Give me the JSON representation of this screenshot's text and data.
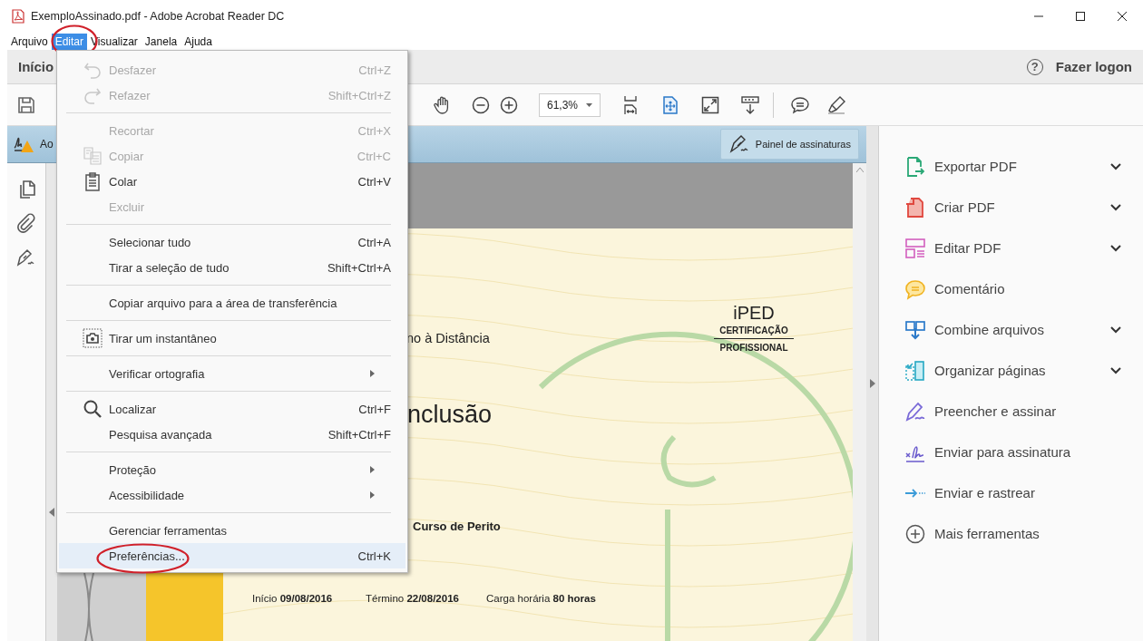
{
  "window": {
    "title": "ExemploAssinado.pdf - Adobe Acrobat Reader DC"
  },
  "menu_bar": [
    {
      "label": "Arquivo",
      "selected": false,
      "circled": false
    },
    {
      "label": "Editar",
      "selected": true,
      "circled": true
    },
    {
      "label": "Visualizar",
      "selected": false,
      "circled": false
    },
    {
      "label": "Janela",
      "selected": false,
      "circled": false
    },
    {
      "label": "Ajuda",
      "selected": false,
      "circled": false
    }
  ],
  "tab_bar": {
    "tab": "Início",
    "help": "?",
    "login": "Fazer logon"
  },
  "toolbar": {
    "zoom": "61,3%"
  },
  "signature_bar": {
    "message": "Ao",
    "button": "Painel de assinaturas"
  },
  "edit_menu": [
    {
      "kind": "item",
      "label": "Desfazer",
      "shortcut": "Ctrl+Z",
      "disabled": true,
      "submenu": false,
      "selected": false,
      "circled": false
    },
    {
      "kind": "item",
      "label": "Refazer",
      "shortcut": "Shift+Ctrl+Z",
      "disabled": true,
      "submenu": false,
      "selected": false,
      "circled": false
    },
    {
      "kind": "separator"
    },
    {
      "kind": "item",
      "label": "Recortar",
      "shortcut": "Ctrl+X",
      "disabled": true,
      "submenu": false,
      "selected": false,
      "circled": false
    },
    {
      "kind": "item",
      "label": "Copiar",
      "shortcut": "Ctrl+C",
      "disabled": true,
      "submenu": false,
      "selected": false,
      "circled": false
    },
    {
      "kind": "item",
      "label": "Colar",
      "shortcut": "Ctrl+V",
      "disabled": false,
      "submenu": false,
      "selected": false,
      "circled": false
    },
    {
      "kind": "item",
      "label": "Excluir",
      "disabled": true,
      "submenu": false,
      "selected": false,
      "circled": false
    },
    {
      "kind": "separator"
    },
    {
      "kind": "item",
      "label": "Selecionar tudo",
      "shortcut": "Ctrl+A",
      "disabled": false,
      "submenu": false,
      "selected": false,
      "circled": false
    },
    {
      "kind": "item",
      "label": "Tirar a seleção de tudo",
      "shortcut": "Shift+Ctrl+A",
      "disabled": false,
      "submenu": false,
      "selected": false,
      "circled": false
    },
    {
      "kind": "separator"
    },
    {
      "kind": "item",
      "label": "Copiar arquivo para a área de transferência",
      "disabled": false,
      "submenu": false,
      "selected": false,
      "circled": false
    },
    {
      "kind": "separator"
    },
    {
      "kind": "item",
      "label": "Tirar um instantâneo",
      "disabled": false,
      "submenu": false,
      "selected": false,
      "circled": false
    },
    {
      "kind": "separator"
    },
    {
      "kind": "item",
      "label": "Verificar ortografia",
      "disabled": false,
      "submenu": true,
      "selected": false,
      "circled": false
    },
    {
      "kind": "separator"
    },
    {
      "kind": "item",
      "label": "Localizar",
      "shortcut": "Ctrl+F",
      "disabled": false,
      "submenu": false,
      "selected": false,
      "circled": false
    },
    {
      "kind": "item",
      "label": "Pesquisa avançada",
      "shortcut": "Shift+Ctrl+F",
      "disabled": false,
      "submenu": false,
      "selected": false,
      "circled": false
    },
    {
      "kind": "separator"
    },
    {
      "kind": "item",
      "label": "Proteção",
      "disabled": false,
      "submenu": true,
      "selected": false,
      "circled": false
    },
    {
      "kind": "item",
      "label": "Acessibilidade",
      "disabled": false,
      "submenu": true,
      "selected": false,
      "circled": false
    },
    {
      "kind": "separator"
    },
    {
      "kind": "item",
      "label": "Gerenciar ferramentas",
      "disabled": false,
      "submenu": false,
      "selected": false,
      "circled": false
    },
    {
      "kind": "item",
      "label": "Preferências...",
      "shortcut": "Ctrl+K",
      "disabled": false,
      "submenu": false,
      "selected": true,
      "circled": true
    }
  ],
  "document": {
    "subtitle": "no à Distância",
    "title": "nclusão",
    "course": "Curso de Perito",
    "details": [
      "Início **09/08/2016**",
      "Término **22/08/2016**",
      "Carga horária  **80 horas**"
    ],
    "logo": {
      "name": "iPED",
      "line1": "CERTIFICAÇÃO",
      "line2": "PROFISSIONAL"
    }
  },
  "tools_panel": [
    {
      "label": "Exportar PDF",
      "expandable": true
    },
    {
      "label": "Criar PDF",
      "expandable": true
    },
    {
      "label": "Editar PDF",
      "expandable": true
    },
    {
      "label": "Comentário",
      "expandable": false
    },
    {
      "label": "Combine arquivos",
      "expandable": true
    },
    {
      "label": "Organizar páginas",
      "expandable": true
    },
    {
      "label": "Preencher e assinar",
      "expandable": false
    },
    {
      "label": "Enviar para assinatura",
      "expandable": false
    },
    {
      "label": "Enviar e rastrear",
      "expandable": false
    },
    {
      "label": "Mais ferramentas",
      "expandable": false
    }
  ]
}
